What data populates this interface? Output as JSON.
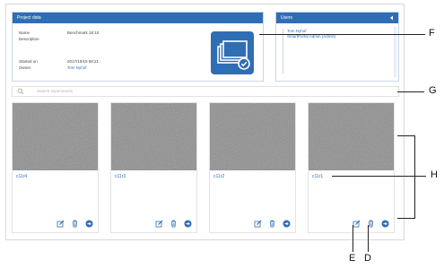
{
  "project_data": {
    "header": "Project data",
    "fields": [
      {
        "label": "Name",
        "value": "Benchmark 19:10"
      },
      {
        "label": "Description",
        "value": ""
      },
      {
        "label": "Started on",
        "value": "2017/10/19 08:21"
      },
      {
        "label": "Owner",
        "value": "Tom Nyhof"
      }
    ]
  },
  "users": {
    "header": "Users",
    "items": [
      "Tom Nyhof",
      "SmartPortal Admin (Admin)"
    ]
  },
  "search": {
    "placeholder": "Search experiments"
  },
  "experiments": [
    {
      "name": "c11r4"
    },
    {
      "name": "c11r3"
    },
    {
      "name": "c11r2"
    },
    {
      "name": "c11r1"
    }
  ],
  "callouts": {
    "F": "F",
    "G": "G",
    "H": "H",
    "E": "E",
    "D": "D"
  },
  "colors": {
    "accent": "#2f6db5",
    "panel_border": "#c9d6e6"
  },
  "icons": {
    "edit": "edit-icon",
    "delete": "trash-icon",
    "open": "arrow-circle-icon",
    "search": "search-icon",
    "project": "stacked-images-icon"
  }
}
